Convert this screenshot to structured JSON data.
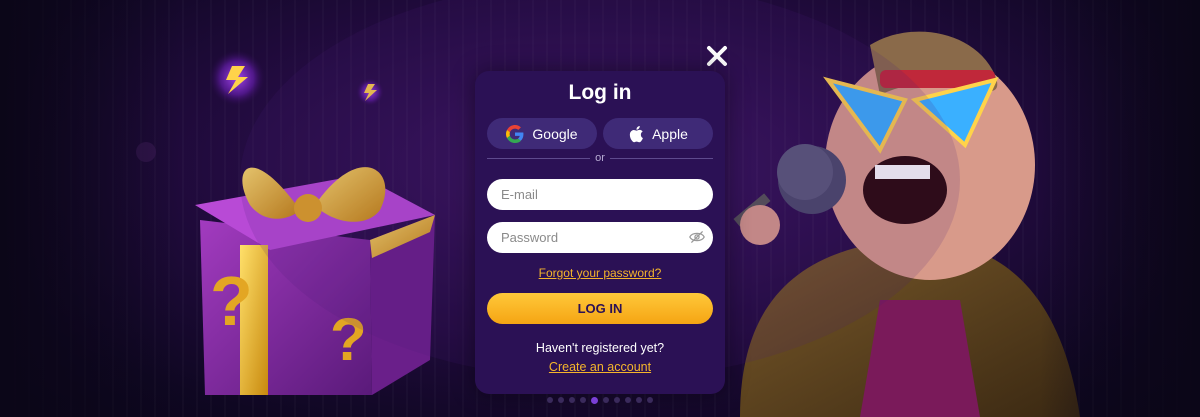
{
  "modal": {
    "title": "Log in",
    "google_label": "Google",
    "apple_label": "Apple",
    "or_text": "or",
    "email_placeholder": "E-mail",
    "password_placeholder": "Password",
    "forgot_label": "Forgot your password?",
    "login_label": "LOG IN",
    "not_registered_text": "Haven't registered yet?",
    "create_account_label": "Create an account",
    "close_icon": "close-icon"
  },
  "colors": {
    "modal_bg": "#2b1155",
    "accent": "#f5b52b",
    "social_bg": "#3f2a77"
  },
  "carousel": {
    "count": 10,
    "active_index": 4
  }
}
